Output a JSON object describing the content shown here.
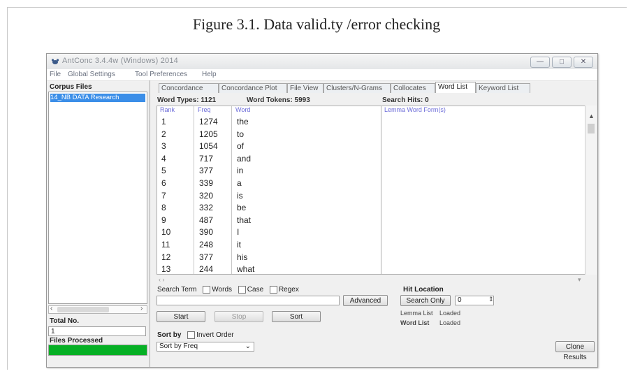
{
  "caption": "Figure 3.1. Data valid.ty /error checking",
  "window": {
    "title": "AntConc 3.4.4w (Windows) 2014",
    "controls": [
      "—",
      "□",
      "✕"
    ]
  },
  "menu": [
    "File",
    "Global Settings",
    "Tool Preferences",
    "Help"
  ],
  "sidebar": {
    "corpus_files_label": "Corpus Files",
    "selected_file": "14_NB DATA Research",
    "total_no_label": "Total No.",
    "total_no_value": "1",
    "files_processed_label": "Files Processed",
    "files_processed_progress": 1.0
  },
  "tabs": [
    "Concordance",
    "Concordance Plot",
    "File View",
    "Clusters/N-Grams",
    "Collocates",
    "Word List",
    "Keyword List"
  ],
  "active_tab": "Word List",
  "stats": {
    "word_types": "Word Types: 1121",
    "word_tokens": "Word Tokens: 5993",
    "search_hits": "Search Hits: 0"
  },
  "table": {
    "headers": [
      "Rank",
      "Freq",
      "Word"
    ],
    "lemma_header": "Lemma Word Form(s)",
    "rows": [
      [
        "1",
        "1274",
        "the"
      ],
      [
        "2",
        "1205",
        "to"
      ],
      [
        "3",
        "1054",
        "of"
      ],
      [
        "4",
        "717",
        "and"
      ],
      [
        "5",
        "377",
        "in"
      ],
      [
        "6",
        "339",
        "a"
      ],
      [
        "7",
        "320",
        "is"
      ],
      [
        "8",
        "332",
        "be"
      ],
      [
        "9",
        "487",
        "that"
      ],
      [
        "10",
        "390",
        "I"
      ],
      [
        "11",
        "248",
        "it"
      ],
      [
        "12",
        "377",
        "his"
      ],
      [
        "13",
        "244",
        "what"
      ]
    ]
  },
  "search": {
    "term_label": "Search Term",
    "words_label": "Words",
    "case_label": "Case",
    "regex_label": "Regex",
    "term_value": "",
    "advanced_label": "Advanced",
    "start_label": "Start",
    "stop_label": "Stop",
    "sort_label": "Sort",
    "hit_location_label": "Hit Location",
    "search_only_label": "Search Only",
    "search_only_value": "0",
    "lemma_list_label": "Lemma List",
    "word_list_label": "Word List",
    "loaded_label": "Loaded",
    "sort_by_label": "Sort by",
    "invert_order_label": "Invert Order",
    "sort_by_value": "Sort by Freq",
    "clone_results_label": "Clone Results"
  }
}
